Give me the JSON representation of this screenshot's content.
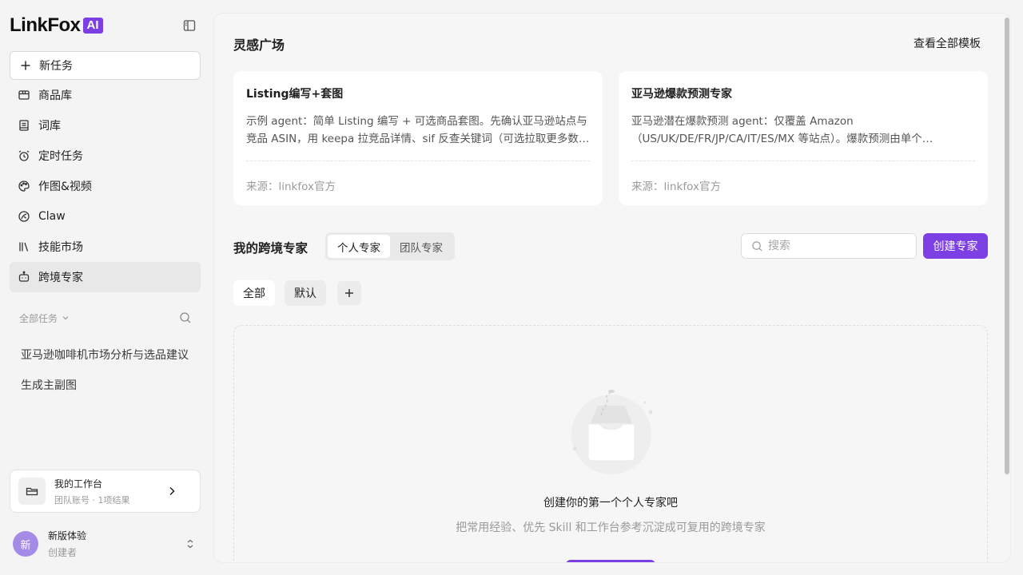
{
  "brand": {
    "name": "LinkFox",
    "badge": "AI",
    "accent": "#7b3fe4"
  },
  "sidebar": {
    "new_task": "新任务",
    "nav": [
      {
        "label": "商品库",
        "icon": "package-icon"
      },
      {
        "label": "词库",
        "icon": "book-icon"
      },
      {
        "label": "定时任务",
        "icon": "alarm-clock-icon"
      },
      {
        "label": "作图&视频",
        "icon": "palette-icon"
      },
      {
        "label": "Claw",
        "icon": "leaf-icon"
      },
      {
        "label": "技能市场",
        "icon": "library-icon"
      },
      {
        "label": "跨境专家",
        "icon": "robot-icon",
        "active": true
      }
    ],
    "tasks_header": "全部任务",
    "tasks": [
      "亚马逊咖啡机市场分析与选品建议",
      "生成主副图"
    ],
    "workspace": {
      "title": "我的工作台",
      "subtitle": "团队账号 · 1项结果"
    },
    "user": {
      "avatar": "新",
      "name": "新版体验",
      "role": "创建者"
    }
  },
  "main": {
    "inspiration_title": "灵感广场",
    "view_all": "查看全部模板",
    "cards": [
      {
        "title": "Listing编写+套图",
        "desc": "示例 agent：简单 Listing 编写 + 可选商品套图。先确认亚马逊站点与竞品 ASIN，用 keepa 拉竞品详情、sif 反查关键词（可选拉取更多数据）…",
        "source": "来源：linkfox官方"
      },
      {
        "title": "亚马逊爆款预测专家",
        "desc": "亚马逊潜在爆款预测 agent：仅覆盖 Amazon（US/UK/DE/FR/JP/CA/IT/ES/MX 等站点）。爆款预测由单个…",
        "source": "来源：linkfox官方"
      }
    ],
    "experts_title": "我的跨境专家",
    "tabs": [
      "个人专家",
      "团队专家"
    ],
    "search_placeholder": "搜索",
    "create_label": "创建专家",
    "filters": [
      "全部",
      "默认"
    ],
    "empty_title": "创建你的第一个个人专家吧",
    "empty_sub": "把常用经验、优先 Skill 和工作台参考沉淀成可复用的跨境专家"
  }
}
